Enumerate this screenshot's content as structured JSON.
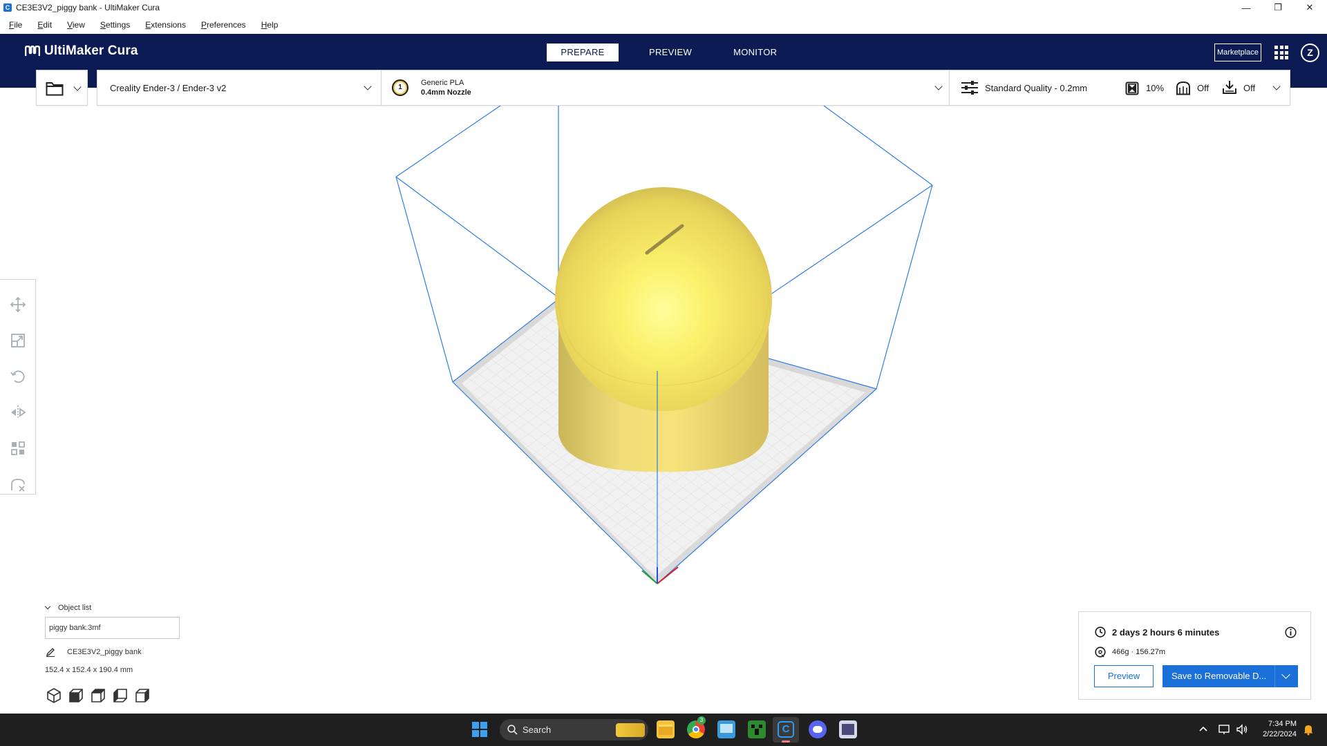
{
  "window": {
    "title": "CE3E3V2_piggy bank - UltiMaker Cura",
    "minimize": "—",
    "restore": "❐",
    "close": "✕"
  },
  "menu": [
    {
      "label": "File",
      "key": "F",
      "rest": "ile"
    },
    {
      "label": "Edit",
      "key": "E",
      "rest": "dit"
    },
    {
      "label": "View",
      "key": "V",
      "rest": "iew"
    },
    {
      "label": "Settings",
      "key": "S",
      "rest": "ettings"
    },
    {
      "label": "Extensions",
      "key": "E",
      "rest": "xtensions"
    },
    {
      "label": "Preferences",
      "key": "P",
      "rest": "references"
    },
    {
      "label": "Help",
      "key": "H",
      "rest": "elp"
    }
  ],
  "header": {
    "brand": "UltiMaker Cura",
    "stages": [
      "PREPARE",
      "PREVIEW",
      "MONITOR"
    ],
    "active_stage": "PREPARE",
    "marketplace": "Marketplace",
    "account_initial": "Z"
  },
  "toolbar": {
    "printer": "Creality Ender-3 / Ender-3 v2",
    "extruder_number": "1",
    "material": "Generic PLA",
    "nozzle": "0.4mm Nozzle",
    "profile": "Standard Quality - 0.2mm",
    "infill": "10%",
    "support": "Off",
    "adhesion": "Off"
  },
  "object_list": {
    "header": "Object list",
    "file": "piggy bank.3mf",
    "object_name": "CE3E3V2_piggy bank",
    "dimensions": "152.4 x 152.4 x 190.4 mm"
  },
  "print_info": {
    "time": "2 days 2 hours 6 minutes",
    "material": "466g · 156.27m",
    "preview_button": "Preview",
    "save_button": "Save to Removable D..."
  },
  "taskbar": {
    "search": "Search",
    "time": "7:34 PM",
    "date": "2/22/2024",
    "chrome_badge": "3"
  },
  "colors": {
    "header_bg": "#0c1b53",
    "accent": "#1b6fd8",
    "model_yellow": "#f5e06a",
    "build_volume": "#2f7de0"
  }
}
